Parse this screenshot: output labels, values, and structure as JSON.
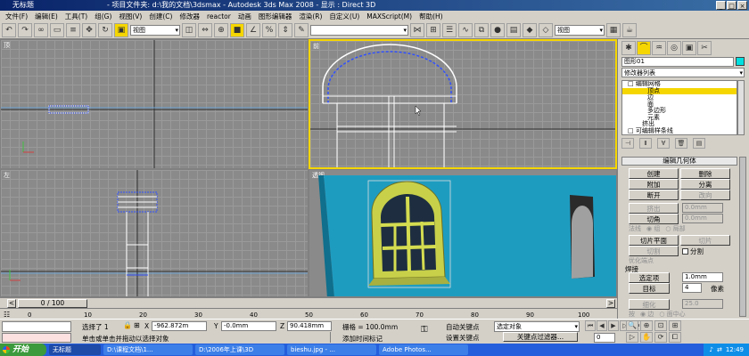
{
  "titlebar": {
    "left_title": "无标题",
    "center_title": "- 项目文件夹: d:\\我的文档\\3dsmax    - Autodesk 3ds Max 2008     - 显示 : Direct 3D",
    "minimize": "_",
    "maximize": "□",
    "close": "×"
  },
  "menu": [
    "文件(F)",
    "编辑(E)",
    "工具(T)",
    "组(G)",
    "视图(V)",
    "创建(C)",
    "修改器",
    "reactor",
    "动画",
    "图形编辑器",
    "渲染(R)",
    "自定义(U)",
    "MAXScript(M)",
    "帮助(H)"
  ],
  "toolbar": {
    "view_select": "视图",
    "view_select2": "视图"
  },
  "viewports": {
    "top": "顶",
    "front": "前",
    "left": "左",
    "persp": "透视"
  },
  "timeslider": {
    "label": "0 / 100",
    "prev": "<",
    "next": ">"
  },
  "ruler": [
    "0",
    "10",
    "20",
    "30",
    "40",
    "50",
    "60",
    "70",
    "80",
    "90",
    "100"
  ],
  "cmd": {
    "object_name": "图形01",
    "modifier_list": "修改器列表",
    "stack": [
      {
        "label": "□ 编辑网格",
        "level": 0
      },
      {
        "label": "顶点",
        "level": 1
      },
      {
        "label": "边",
        "level": 1
      },
      {
        "label": "面",
        "level": 1
      },
      {
        "label": "多边形",
        "level": 1
      },
      {
        "label": "元素",
        "level": 1
      },
      {
        "label": "挤出",
        "level": 0
      },
      {
        "label": "□ 可编辑样条线",
        "level": 0
      }
    ],
    "rollout_title": "编辑几何体",
    "btn_create": "创建",
    "btn_delete": "删除",
    "btn_attach": "附加",
    "btn_detach": "分离",
    "btn_break": "断开",
    "btn_turn": "改向",
    "extrude_label": "挤出",
    "extrude_val": "0.0mm",
    "chamfer_label": "切角",
    "chamfer_val": "0.0mm",
    "normal_label": "法线",
    "normal_group": "◉ 组",
    "normal_local": "○ 局部",
    "slice_plane": "切片平面",
    "slice": "切片",
    "cut": "切割",
    "split": "分割",
    "refine_ends": "优化端点",
    "weld_title": "焊接",
    "weld_selected": "选定项",
    "weld_selected_val": "1.0mm",
    "weld_target": "目标",
    "weld_target_val": "4",
    "weld_pixels": "像素",
    "tessellate": "细化",
    "tessellate_val": "25.0",
    "by_label": "按",
    "by_edge": "◉ 边",
    "by_face": "○ 面中心"
  },
  "status": {
    "selected": "选择了 1",
    "x_label": "X",
    "x_val": "-962.872m",
    "y_label": "Y",
    "y_val": "-0.0mm",
    "z_label": "Z",
    "z_val": "90.418mm",
    "grid": "栅格 = 100.0mm",
    "auto_key": "自动关键点",
    "set_key": "设置关键点",
    "sel_obj": "选定对象",
    "key_filter": "关键点过滤器...",
    "frame": "0",
    "prompt": "单击或单击并拖动以选择对象",
    "add_time_tag": "添加时间标记"
  },
  "taskbar": {
    "start": "开始",
    "tasks": [
      "无标题",
      "D:\\课程文档\\1...",
      "D:\\2006年上课\\3D",
      "bieshu.jpg - ...",
      "Adobe Photos..."
    ],
    "clock": "12:49"
  }
}
